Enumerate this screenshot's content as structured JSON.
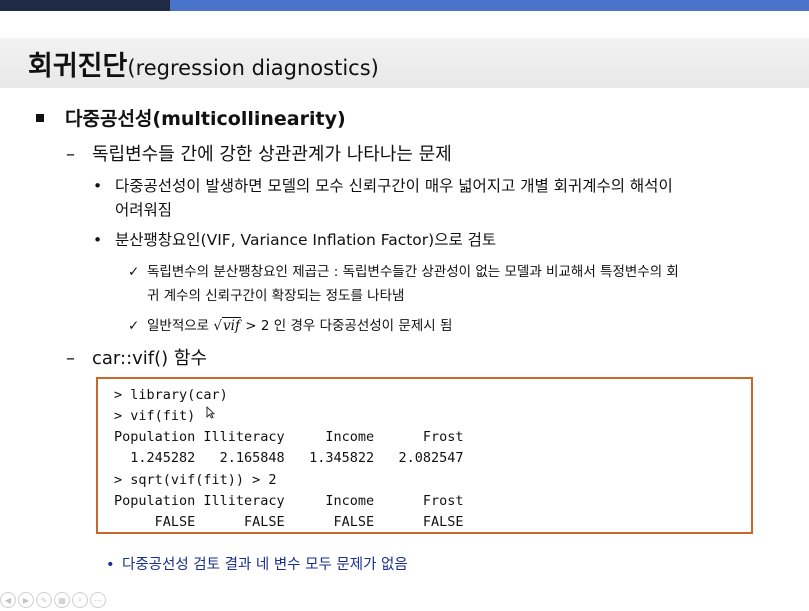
{
  "title": {
    "ko": "회귀진단",
    "en": "(regression diagnostics)"
  },
  "section": {
    "bullet": "■",
    "label": "다중공선성(multicollinearity)"
  },
  "sub1": {
    "dash": "–",
    "text": "독립변수들 간에 강한 상관관계가 나타나는 문제"
  },
  "sub1_items": [
    {
      "dot": "•",
      "line1": "다중공선성이 발생하면 모델의 모수 신뢰구간이 매우 넓어지고 개별 회귀계수의 해석이",
      "line2": "어려워짐"
    },
    {
      "dot": "•",
      "line1": "분산팽창요인(VIF, Variance Inflation Factor)으로 검토"
    }
  ],
  "checks": [
    {
      "mark": "✓",
      "line1": "독립변수의 분산팽창요인 제곱근 : 독립변수들간 상관성이 없는 모델과 비교해서 특정변수의 회",
      "line2": "귀 계수의 신뢰구간이 확장되는 정도를 나타냄"
    },
    {
      "mark": "✓",
      "pre": "일반적으로 ",
      "radical": "vif",
      "post": " > 2 인 경우 다중공선성이 문제시 됨"
    }
  ],
  "sub2": {
    "dash": "–",
    "text": "car::vif() 함수"
  },
  "code_lines": [
    "> library(car)",
    "> vif(fit)",
    "Population Illiteracy     Income      Frost",
    "  1.245282   2.165848   1.345822   2.082547",
    "> sqrt(vif(fit)) > 2",
    "Population Illiteracy     Income      Frost",
    "     FALSE      FALSE      FALSE      FALSE"
  ],
  "note": {
    "dot": "•",
    "text": "다중공선성 검토 결과 네 변수 모두 문제가 없음"
  },
  "icons": {
    "cursor": "mouse-pointer-icon"
  },
  "colors": {
    "accent_dark": "#1f2a44",
    "accent_light": "#4a74c9",
    "code_border": "#c8682a",
    "note": "#1a2e8f"
  }
}
